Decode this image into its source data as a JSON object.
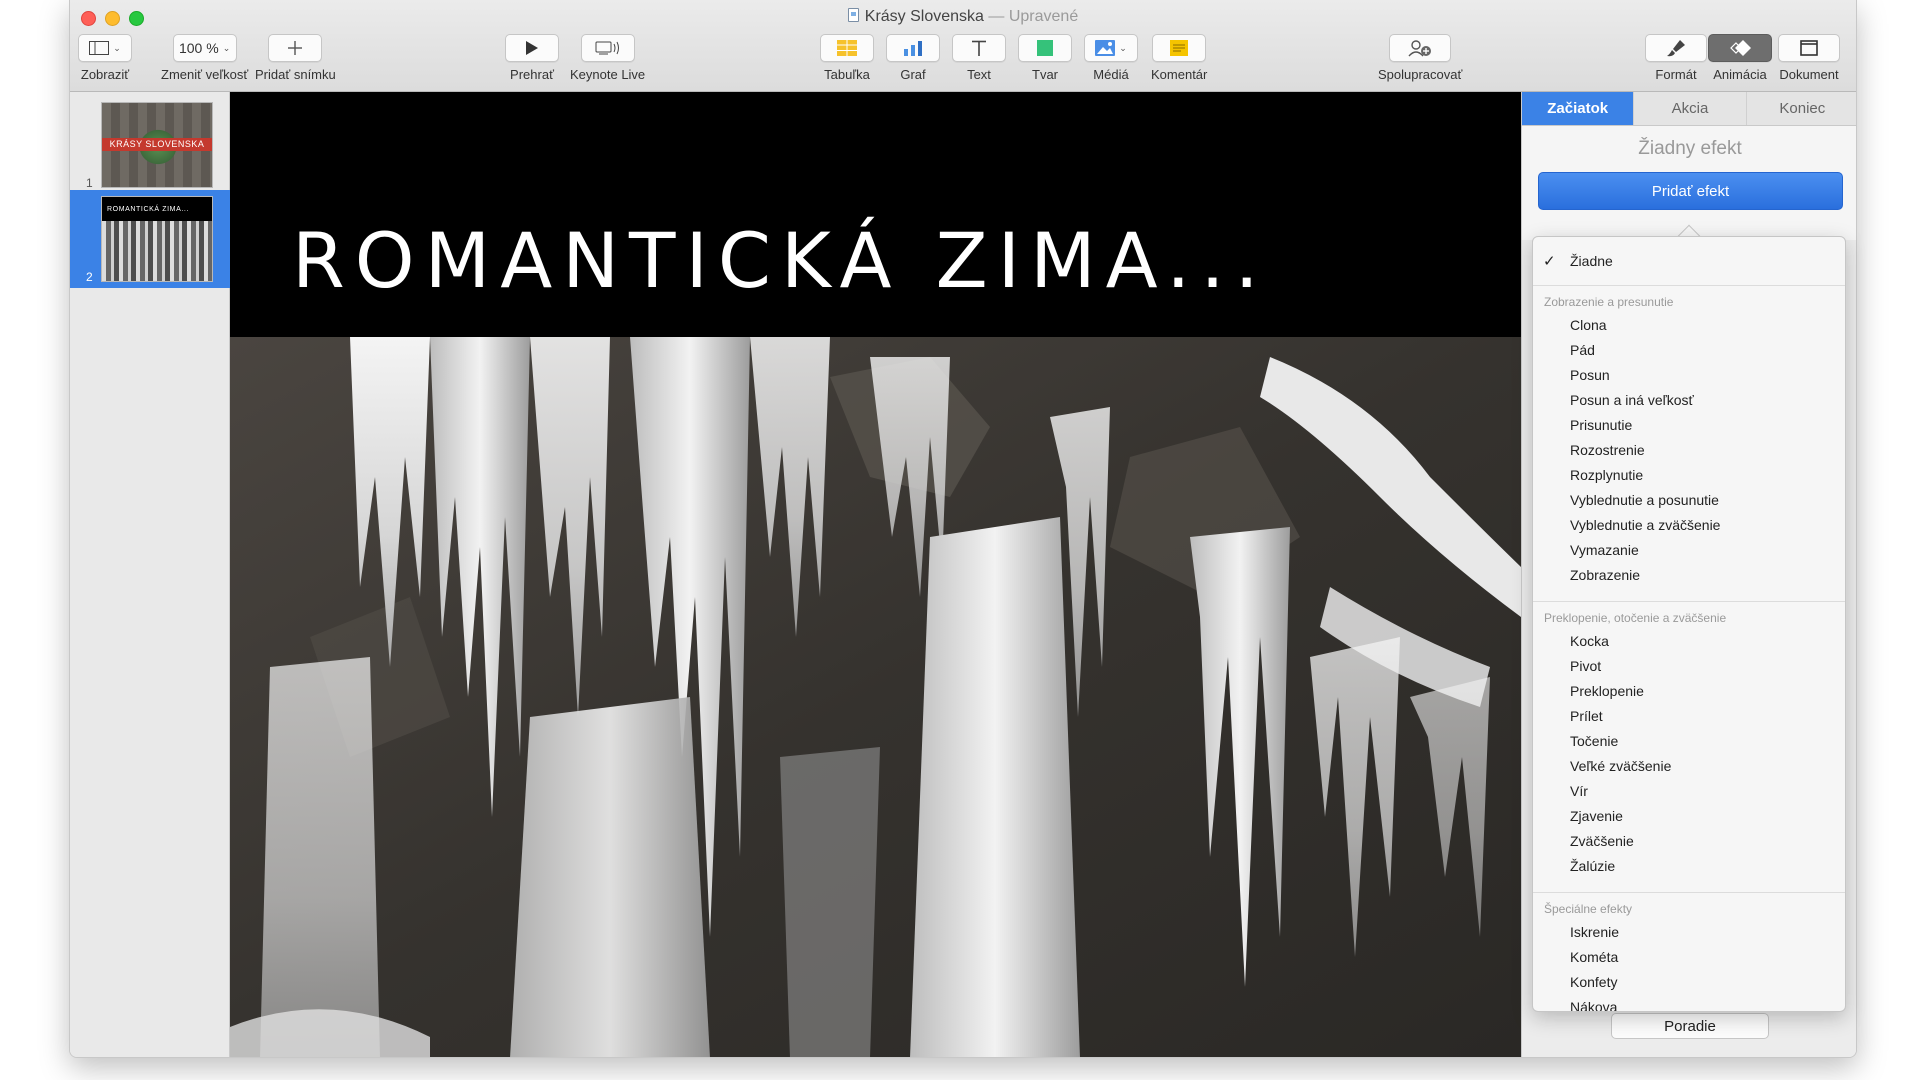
{
  "window": {
    "title": "Krásy Slovenska",
    "separator": "—",
    "edited_label": "Upravené"
  },
  "toolbar": {
    "view": {
      "label": "Zobraziť",
      "icon": "sidebar-view-icon"
    },
    "zoom": {
      "label": "Zmeniť veľkosť",
      "value": "100 %"
    },
    "add_slide": {
      "label": "Pridať snímku",
      "icon": "plus-icon"
    },
    "play": {
      "label": "Prehrať",
      "icon": "play-icon"
    },
    "keynote_live": {
      "label": "Keynote Live",
      "icon": "keynote-live-icon"
    },
    "table": {
      "label": "Tabuľka",
      "icon": "table-icon"
    },
    "chart": {
      "label": "Graf",
      "icon": "chart-icon"
    },
    "text": {
      "label": "Text",
      "icon": "text-icon"
    },
    "shape": {
      "label": "Tvar",
      "icon": "shape-icon"
    },
    "media": {
      "label": "Médiá",
      "icon": "media-icon"
    },
    "comment": {
      "label": "Komentár",
      "icon": "comment-icon"
    },
    "collaborate": {
      "label": "Spolupracovať",
      "icon": "collaborate-icon"
    },
    "format": {
      "label": "Formát",
      "icon": "format-brush-icon"
    },
    "animate": {
      "label": "Animácia",
      "icon": "animate-diamond-icon",
      "selected": true
    },
    "document": {
      "label": "Dokument",
      "icon": "document-icon"
    }
  },
  "navigator": {
    "slides": [
      {
        "number": "1",
        "thumb_text": "KRÁSY SLOVENSKA",
        "selected": false
      },
      {
        "number": "2",
        "thumb_text": "ROMANTICKÁ ZIMA...",
        "selected": true
      }
    ]
  },
  "slide": {
    "title": "ROMANTICKÁ ZIMA..."
  },
  "inspector": {
    "tabs": [
      {
        "label": "Začiatok",
        "active": true
      },
      {
        "label": "Akcia",
        "active": false
      },
      {
        "label": "Koniec",
        "active": false
      }
    ],
    "no_effect": "Žiadny efekt",
    "add_effect": "Pridať efekt",
    "order_button": "Poradie"
  },
  "effects_menu": {
    "none": "Žiadne",
    "sections": [
      {
        "header": "Zobrazenie a presunutie",
        "items": [
          "Clona",
          "Pád",
          "Posun",
          "Posun a iná veľkosť",
          "Prisunutie",
          "Rozostrenie",
          "Rozplynutie",
          "Vyblednutie a posunutie",
          "Vyblednutie a zväčšenie",
          "Vymazanie",
          "Zobrazenie"
        ]
      },
      {
        "header": "Preklopenie, otočenie a zväčšenie",
        "items": [
          "Kocka",
          "Pivot",
          "Preklopenie",
          "Prílet",
          "Točenie",
          "Veľké zväčšenie",
          "Vír",
          "Zjavenie",
          "Zväčšenie",
          "Žalúzie"
        ]
      },
      {
        "header": "Špeciálne efekty",
        "items": [
          "Iskrenie",
          "Kométa",
          "Konfety",
          "Nákova"
        ]
      }
    ]
  },
  "colors": {
    "accent": "#3b82e6",
    "slide_background": "#000000"
  }
}
